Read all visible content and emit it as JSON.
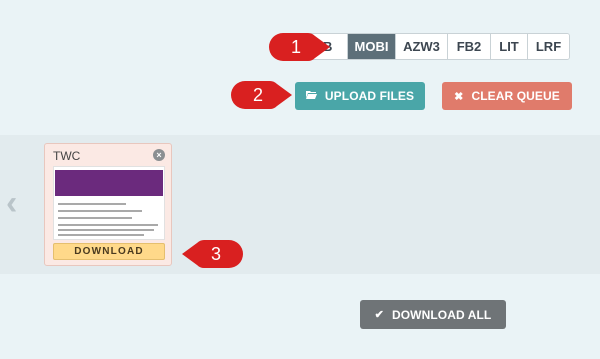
{
  "formats": [
    {
      "label": "UB",
      "active": false
    },
    {
      "label": "MOBI",
      "active": true
    },
    {
      "label": "AZW3",
      "active": false
    },
    {
      "label": "FB2",
      "active": false
    },
    {
      "label": "LIT",
      "active": false
    },
    {
      "label": "LRF",
      "active": false
    }
  ],
  "actions": {
    "upload_label": "UPLOAD FILES",
    "clear_label": "CLEAR QUEUE",
    "download_all_label": "DOWNLOAD ALL"
  },
  "queue": {
    "card": {
      "title": "TWC",
      "download_label": "DOWNLOAD"
    }
  },
  "callouts": [
    "1",
    "2",
    "3"
  ],
  "colors": {
    "accent_teal": "#4aa6a8",
    "accent_red": "#e07b6b",
    "callout_red": "#d92020",
    "active_tab": "#5d6f79"
  },
  "icons": {
    "upload": "folder-open-icon",
    "clear": "close-icon",
    "download_all": "check-icon",
    "carousel_prev": "chevron-left-icon",
    "card_remove": "remove-circle-icon"
  }
}
